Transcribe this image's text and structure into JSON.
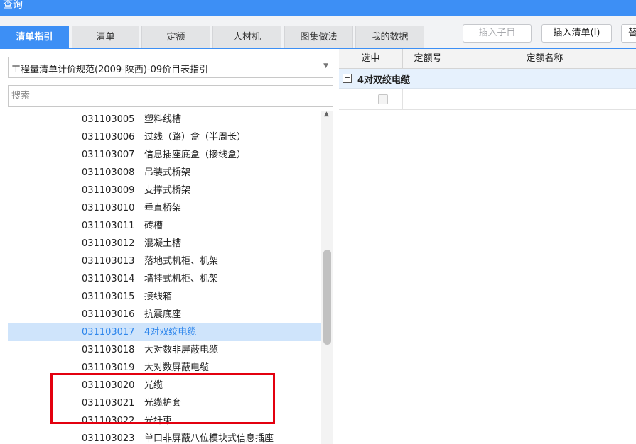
{
  "window": {
    "title": "查询"
  },
  "tabs": [
    {
      "label": "清单指引",
      "active": true
    },
    {
      "label": "清单",
      "active": false
    },
    {
      "label": "定额",
      "active": false
    },
    {
      "label": "人材机",
      "active": false
    },
    {
      "label": "图集做法",
      "active": false
    },
    {
      "label": "我的数据",
      "active": false
    }
  ],
  "toolbar": {
    "insert_child_label": "插入子目",
    "insert_child_enabled": false,
    "insert_list_label": "插入清单(I)",
    "replace_label": "替"
  },
  "left": {
    "standard_select": "工程量清单计价规范(2009-陕西)-09价目表指引",
    "search_placeholder": "搜索",
    "tree_items": [
      {
        "code": "031103005",
        "name": "塑料线槽"
      },
      {
        "code": "031103006",
        "name": "过线（路）盒（半周长）"
      },
      {
        "code": "031103007",
        "name": "信息插座底盒（接线盒）"
      },
      {
        "code": "031103008",
        "name": "吊装式桥架"
      },
      {
        "code": "031103009",
        "name": "支撑式桥架"
      },
      {
        "code": "031103010",
        "name": "垂直桥架"
      },
      {
        "code": "031103011",
        "name": "砖槽"
      },
      {
        "code": "031103012",
        "name": "混凝土槽"
      },
      {
        "code": "031103013",
        "name": "落地式机柜、机架"
      },
      {
        "code": "031103014",
        "name": "墙挂式机柜、机架"
      },
      {
        "code": "031103015",
        "name": "接线箱"
      },
      {
        "code": "031103016",
        "name": "抗震底座"
      },
      {
        "code": "031103017",
        "name": "4对双绞电缆",
        "selected": true
      },
      {
        "code": "031103018",
        "name": "大对数非屏蔽电缆"
      },
      {
        "code": "031103019",
        "name": "大对数屏蔽电缆"
      },
      {
        "code": "031103020",
        "name": "光缆"
      },
      {
        "code": "031103021",
        "name": "光缆护套"
      },
      {
        "code": "031103022",
        "name": "光纤束"
      },
      {
        "code": "031103023",
        "name": "单口非屏蔽八位模块式信息插座"
      }
    ]
  },
  "right": {
    "columns": {
      "select": "选中",
      "quota_no": "定额号",
      "quota_name": "定额名称"
    },
    "group_expander": "−",
    "group_label": "4对双绞电缆",
    "rows": [
      {
        "checked": false
      }
    ]
  },
  "colors": {
    "accent": "#3d8ff5",
    "selection_bg": "#cfe4fb",
    "annotation_red": "#e3000f"
  }
}
